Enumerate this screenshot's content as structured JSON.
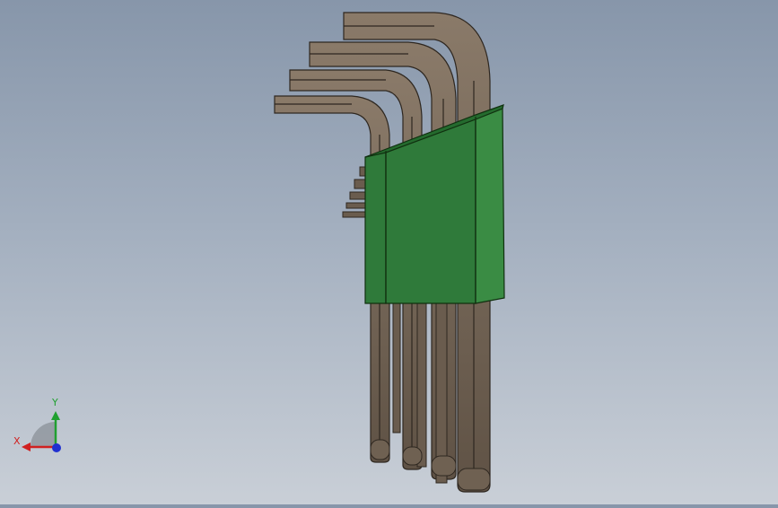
{
  "colors": {
    "background_top": "#8796aa",
    "background_bottom": "#c9cfd7",
    "key_body": "#6f6152",
    "key_edge": "#2e2720",
    "holder_green": "#2f7a3a",
    "holder_green_dark": "#1f5a28",
    "holder_green_light": "#3f9a4a",
    "axis_x": "#d02020",
    "axis_y": "#20a030",
    "axis_z": "#2030d0"
  },
  "icons": {
    "triad": "coordinate-triad-icon"
  },
  "triad": {
    "x_label": "X",
    "y_label": "Y"
  }
}
